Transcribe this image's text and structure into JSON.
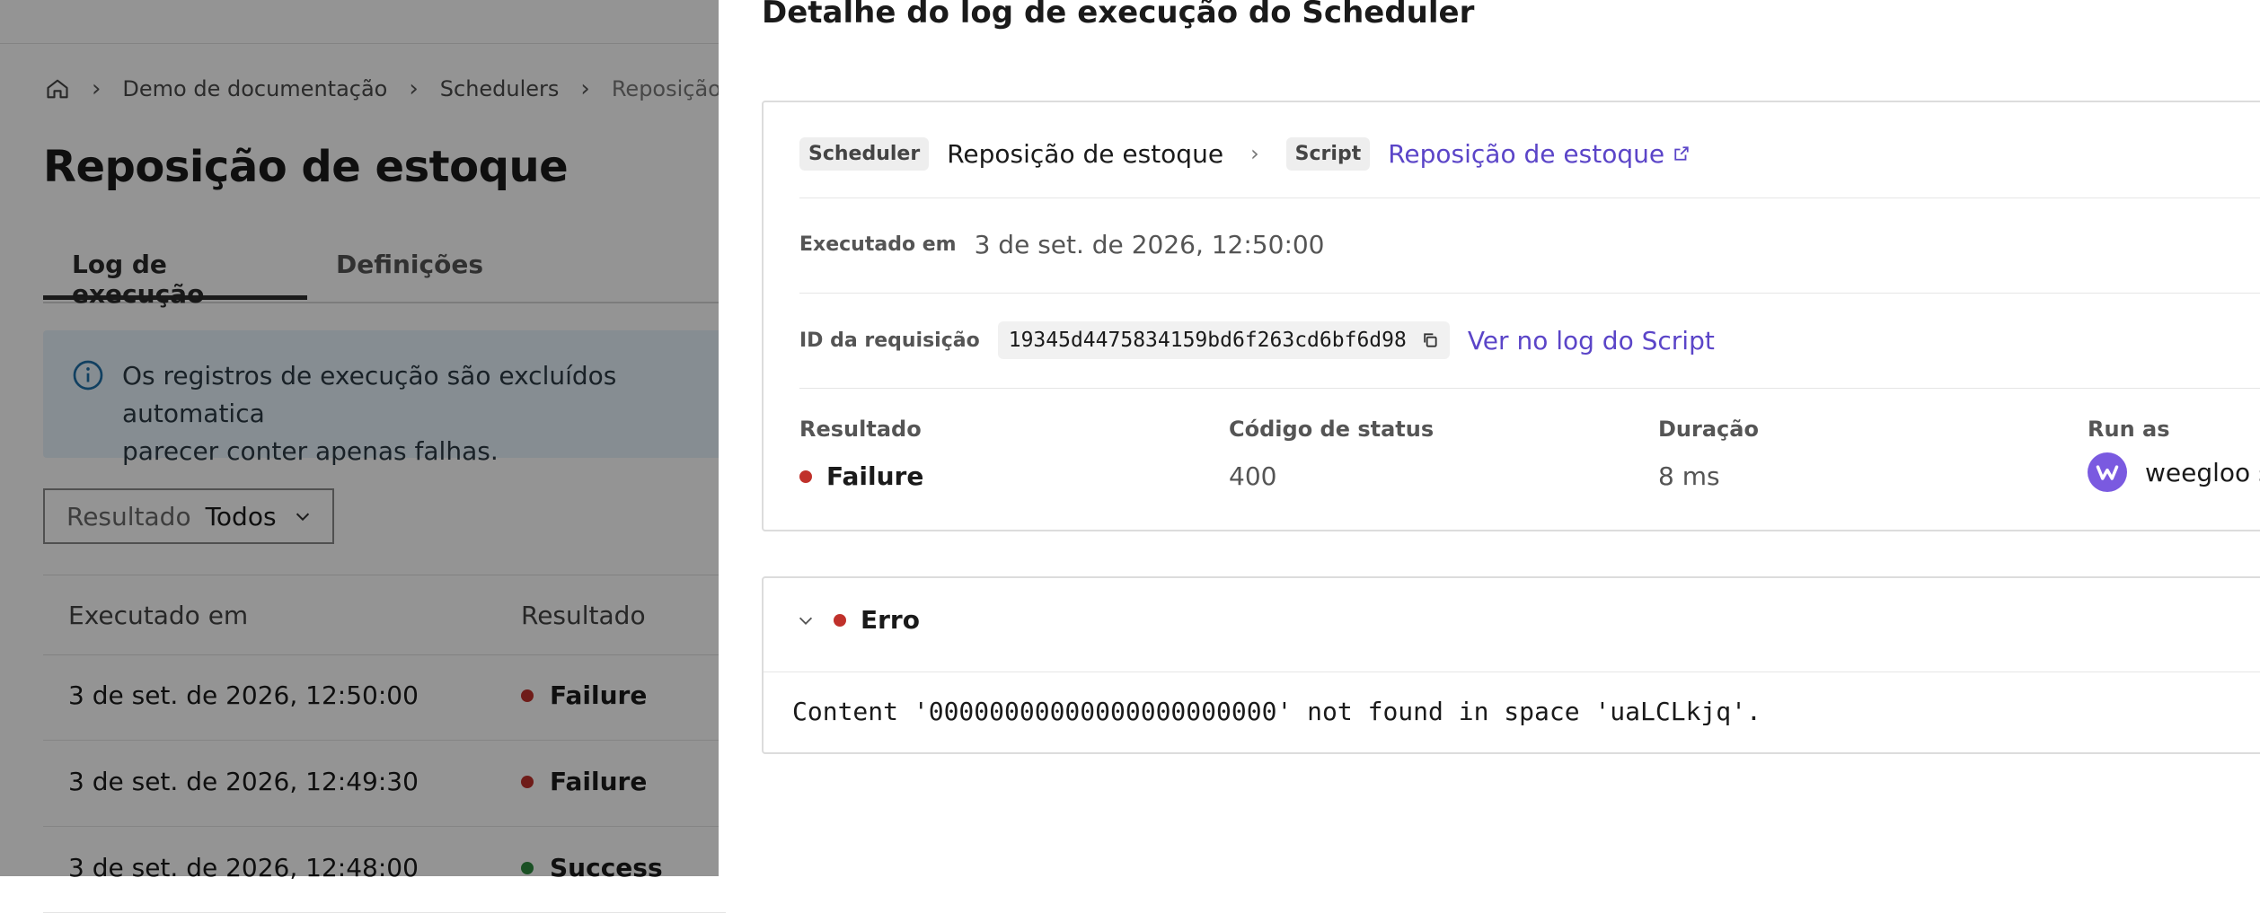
{
  "breadcrumb": {
    "home_icon": "home-icon",
    "items": [
      "Demo de documentação",
      "Schedulers",
      "Reposição de"
    ]
  },
  "page": {
    "title": "Reposição de estoque",
    "tabs": [
      {
        "label": "Log de execução",
        "active": true
      },
      {
        "label": "Definições",
        "active": false
      }
    ],
    "info_banner": "Os registros de execução são excluídos automatica parecer conter apenas falhas.",
    "info_banner_lines": [
      "Os registros de execução são excluídos automatica",
      "parecer conter apenas falhas."
    ],
    "filter": {
      "label": "Resultado",
      "value": "Todos"
    },
    "table": {
      "columns": [
        "Executado em",
        "Resultado"
      ],
      "rows": [
        {
          "date": "3 de set. de 2026, 12:50:00",
          "result": "Failure"
        },
        {
          "date": "3 de set. de 2026, 12:49:30",
          "result": "Failure"
        },
        {
          "date": "3 de set. de 2026, 12:48:00",
          "result": "Success"
        }
      ]
    }
  },
  "drawer": {
    "title": "Detalhe do log de execução do Scheduler",
    "scheduler_tag": "Scheduler",
    "scheduler_name": "Reposição de estoque",
    "script_tag": "Script",
    "script_link": "Reposição de estoque",
    "executed_label": "Executado em",
    "executed_value": "3 de set. de 2026, 12:50:00",
    "request_label": "ID da requisição",
    "request_id": "19345d4475834159bd6f263cd6bf6d98",
    "script_log_link": "Ver no log do Script",
    "stats": {
      "result_label": "Resultado",
      "result_value": "Failure",
      "status_label": "Código de status",
      "status_value": "400",
      "duration_label": "Duração",
      "duration_value": "8 ms",
      "run_as_label": "Run as",
      "run_as_value": "weegloo s"
    },
    "error": {
      "title": "Erro",
      "message": "Content '00000000000000000000000' not found in space 'uaLCLkjq'."
    }
  },
  "colors": {
    "failure": "#c0312b",
    "success": "#2e8b3e",
    "link": "#5b45c8",
    "overlay": "rgba(0,0,0,0.42)",
    "avatar": "#7a5ae0"
  }
}
